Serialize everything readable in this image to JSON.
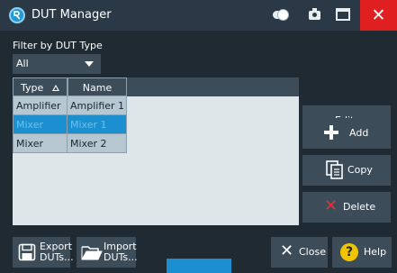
{
  "window": {
    "title": "DUT Manager",
    "close_glyph": "✕"
  },
  "filter": {
    "label": "Filter by DUT Type",
    "selected": "All"
  },
  "table": {
    "columns": [
      "Type",
      "Name"
    ],
    "rows": [
      {
        "type": "Amplifier",
        "name": "Amplifier 1",
        "selected": false
      },
      {
        "type": "Mixer",
        "name": "Mixer 1",
        "selected": true
      },
      {
        "type": "Mixer",
        "name": "Mixer 2",
        "selected": false
      }
    ]
  },
  "side_buttons": {
    "edit": "Edit...",
    "add": "Add",
    "copy": "Copy",
    "delete": "Delete"
  },
  "bottom_buttons": {
    "export_l1": "Export",
    "export_l2": "DUTs...",
    "import_l1": "Import",
    "import_l2": "DUTs...",
    "close": "Close",
    "help": "Help",
    "help_glyph": "?",
    "close_glyph": "✕"
  },
  "colors": {
    "accent": "#1b8fd0",
    "close_red": "#e02020",
    "help_yellow": "#f2c400"
  },
  "icons": [
    "app-logo-icon",
    "toggle-icon",
    "camera-icon",
    "maximize-icon",
    "close-icon",
    "sort-up-icon",
    "plus-icon",
    "copy-icon",
    "delete-x-icon",
    "save-icon",
    "folder-open-icon",
    "close-x-icon",
    "help-icon"
  ]
}
